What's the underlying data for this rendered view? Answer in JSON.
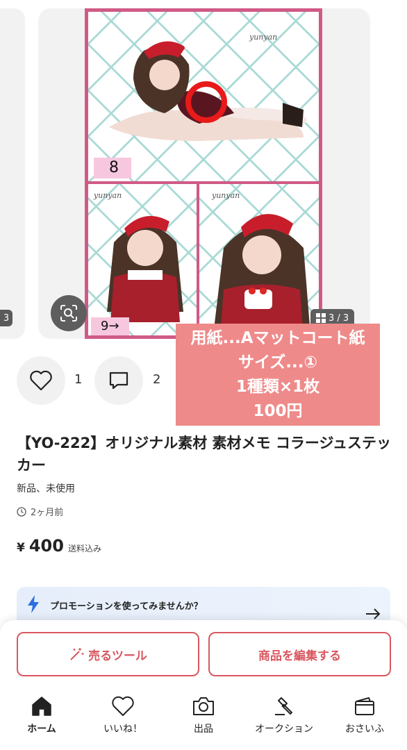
{
  "carousel": {
    "prev_counter": "3",
    "page_counter": "3 / 3",
    "watermark": "yunyan",
    "panel_labels": [
      "8",
      "9→"
    ]
  },
  "overlay": {
    "lines": [
      "用紙...Aマットコート紙",
      "サイズ...①",
      "1種類×1枚",
      "100円"
    ]
  },
  "actions": {
    "like_count": "1",
    "comment_count": "2"
  },
  "product": {
    "title": "【YO-222】オリジナル素材 素材メモ コラージュステッカー",
    "condition": "新品、未使用",
    "time": "2ヶ月前",
    "currency": "¥",
    "price": "400",
    "shipping": "送料込み"
  },
  "promo": {
    "text": "プロモーションを使ってみませんか？"
  },
  "buttons": {
    "sell_tool": "売るツール",
    "edit_item": "商品を編集する"
  },
  "nav": {
    "home": "ホーム",
    "like": "いいね！",
    "sell": "出品",
    "auction": "オークション",
    "wallet": "おさいふ"
  },
  "colors": {
    "accent": "#d9575f",
    "overlay": "#ef8a8a",
    "frame": "#d05a86",
    "grid": "#a9dad6"
  }
}
